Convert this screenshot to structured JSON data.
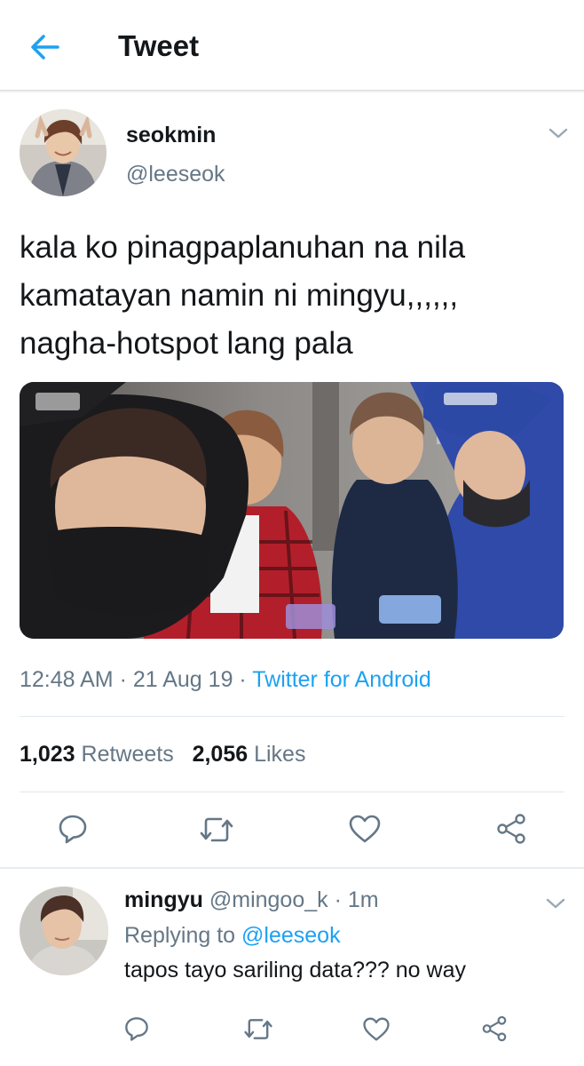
{
  "header": {
    "title": "Tweet",
    "back_icon": "arrow-left-icon"
  },
  "tweet": {
    "author_name": "seokmin",
    "author_handle": "@leeseok",
    "text_lines": [
      "kala ko pinagpaplanuhan na nila",
      "kamatayan namin ni mingyu,,,,,,",
      "nagha-hotspot lang pala"
    ],
    "time": "12:48 AM",
    "date": "21 Aug 19",
    "source": "Twitter for Android",
    "separator": " · ",
    "retweets_count": "1,023",
    "retweets_label": "Retweets",
    "likes_count": "2,056",
    "likes_label": "Likes",
    "actions": [
      "reply-icon",
      "retweet-icon",
      "like-icon",
      "share-icon"
    ]
  },
  "reply": {
    "author_name": "mingyu",
    "author_handle": "@mingoo_k",
    "time_ago": "1m",
    "replying_to_label": "Replying to",
    "replying_to_handle": "@leeseok",
    "text": "tapos tayo sariling data??? no way",
    "actions": [
      "reply-icon",
      "retweet-icon",
      "like-icon",
      "share-icon"
    ]
  },
  "colors": {
    "accent": "#1da1f2",
    "text_primary": "#14171a",
    "text_secondary": "#657786",
    "divider": "#e1e8ed"
  }
}
